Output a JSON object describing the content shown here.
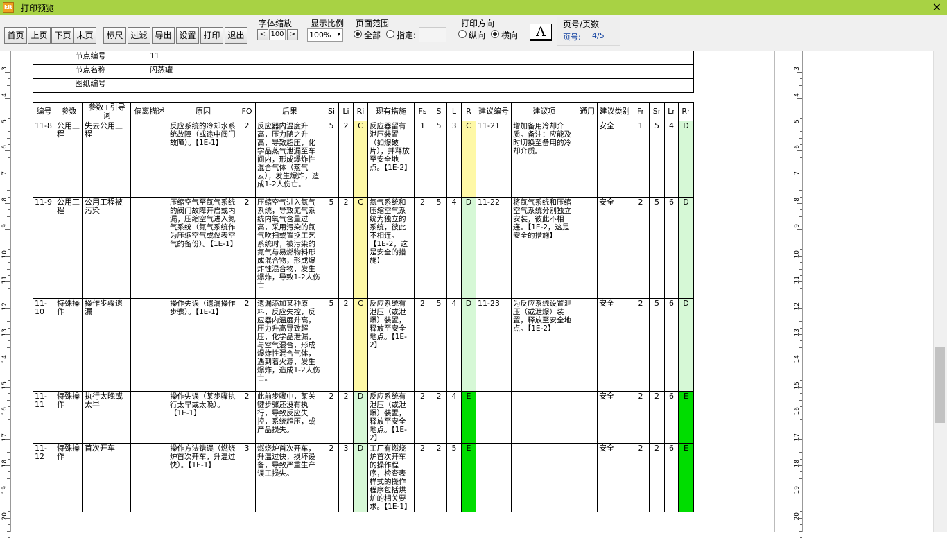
{
  "window": {
    "title": "打印预览",
    "icon": "kit-app-icon",
    "close_glyph": "✕"
  },
  "toolbar": {
    "buttons": [
      "首页",
      "上页",
      "下页",
      "末页",
      "标尺",
      "过滤",
      "导出",
      "设置",
      "打印",
      "退出"
    ],
    "font_scale": {
      "label": "字体缩放",
      "dec": "<",
      "value": "100",
      "inc": ">"
    },
    "zoom": {
      "label": "显示比例",
      "value": "100%"
    },
    "range": {
      "label": "页面范围",
      "all": "全部",
      "specified": "指定:",
      "specified_value": ""
    },
    "orientation": {
      "label": "打印方向",
      "portrait": "纵向",
      "landscape": "横向"
    },
    "font_icon": "A",
    "page": {
      "label": "页号/页数",
      "page_label": "页号:",
      "value": "4/5"
    }
  },
  "ruler": {
    "left": [
      "3",
      "4",
      "5",
      "6",
      "7",
      "8",
      "9",
      "10",
      "11",
      "12",
      "13",
      "14",
      "15",
      "16",
      "17",
      "18",
      "19",
      "20"
    ],
    "right": [
      "3",
      "4",
      "5",
      "6",
      "7",
      "8",
      "9",
      "10",
      "11",
      "12",
      "13",
      "14",
      "15",
      "16",
      "17",
      "18",
      "19",
      "20"
    ]
  },
  "node": {
    "rows": [
      {
        "label": "节点编号",
        "value": "11"
      },
      {
        "label": "节点名称",
        "value": "闪蒸罐"
      },
      {
        "label": "图纸编号",
        "value": ""
      }
    ]
  },
  "table": {
    "headers": [
      "编号",
      "参数",
      "参数+引导词",
      "偏离描述",
      "原因",
      "FO",
      "后果",
      "Si",
      "Li",
      "Ri",
      "现有措施",
      "Fs",
      "S",
      "L",
      "R",
      "建议编号",
      "建议项",
      "通用",
      "建议类别",
      "Fr",
      "Sr",
      "Lr",
      "Rr"
    ],
    "rows": [
      [
        "11-8",
        "公用工程",
        "失去公用工程",
        "",
        "反应系统的冷却水系统故障（或途中阀门故障）。【1E-1】",
        "2",
        "反应器内温度升高，压力随之升高，导致超压，化学品蒸气泄漏至车间内，形成爆炸性混合气体（蒸气云），发生爆炸，造成1-2人伤亡。",
        "5",
        "2",
        "C",
        "反应器留有泄压装置（如爆破片），并释放至安全地点。【1E-2】",
        "1",
        "5",
        "3",
        "C",
        "11-21",
        "增加备用冷却介质。备注：应能及时切换至备用的冷却介质。",
        "",
        "安全",
        "1",
        "5",
        "4",
        "D"
      ],
      [
        "11-9",
        "公用工程",
        "公用工程被污染",
        "",
        "压缩空气至氮气系统的阀门故障开启或内漏，压缩空气进入氮气系统（氮气系统作为压缩空气或仪表空气的备份）。【1E-1】",
        "2",
        "压缩空气进入氮气系统，导致氮气系统内氧气含量过高，采用污染的氮气吹扫或置换工艺系统时，被污染的氮气与易燃物料形成混合物，形成爆炸性混合物，发生爆炸，导致1-2人伤亡",
        "5",
        "2",
        "C",
        "氮气系统和压缩空气系统为独立的系统，彼此不相连。【1E-2，这是安全的措施】",
        "2",
        "5",
        "4",
        "D",
        "11-22",
        "将氮气系统和压缩空气系统分别独立安装，彼此不相连。【1E-2，这是安全的措施】",
        "",
        "安全",
        "2",
        "5",
        "6",
        "D"
      ],
      [
        "11-10",
        "特殊操作",
        "操作步骤遗漏",
        "",
        "操作失误（遗漏操作步骤）。【1E-1】",
        "2",
        "遗漏添加某种原料，反应失控，反应器内温度升高，压力升高导致超压，化学品泄漏，与空气混合，形成爆炸性混合气体，遇到着火源，发生爆炸，造成1-2人伤亡。",
        "5",
        "2",
        "C",
        "反应系统有泄压（或泄爆）装置，释放至安全地点。【1E-2】",
        "2",
        "5",
        "4",
        "D",
        "11-23",
        "为反应系统设置泄压（或泄爆）装置，释放至安全地点。【1E-2】",
        "",
        "安全",
        "2",
        "5",
        "6",
        "D"
      ],
      [
        "11-11",
        "特殊操作",
        "执行太晚或太早",
        "",
        "操作失误（某步骤执行太早或太晚）。【1E-1】",
        "2",
        "此前步骤中，某关键步骤还没有执行，导致反应失控，系统超压，或产品损失。",
        "2",
        "2",
        "D",
        "反应系统有泄压（或泄爆）装置，释放至安全地点。【1E-2】",
        "2",
        "2",
        "4",
        "E",
        "",
        "",
        "",
        "安全",
        "2",
        "2",
        "6",
        "E"
      ],
      [
        "11-12",
        "特殊操作",
        "首次开车",
        "",
        "操作方法错误（燃烧炉首次开车，升温过快）。【1E-1】",
        "3",
        "燃烧炉首次开车，升温过快，损坏设备，导致严重生产误工损失。",
        "2",
        "3",
        "D",
        "工厂有燃烧炉首次开车的操作程序，检查表样式的操作程序包括烘炉的相关要求。【1E-1】",
        "2",
        "2",
        "5",
        "E",
        "",
        "",
        "",
        "安全",
        "2",
        "2",
        "6",
        "E"
      ]
    ]
  },
  "colors": {
    "titlebar": "#a8d244",
    "yellow": "#fef8a6",
    "light_green": "#d6f8d6",
    "green": "#00dd00",
    "page_number": "#1040a0"
  }
}
